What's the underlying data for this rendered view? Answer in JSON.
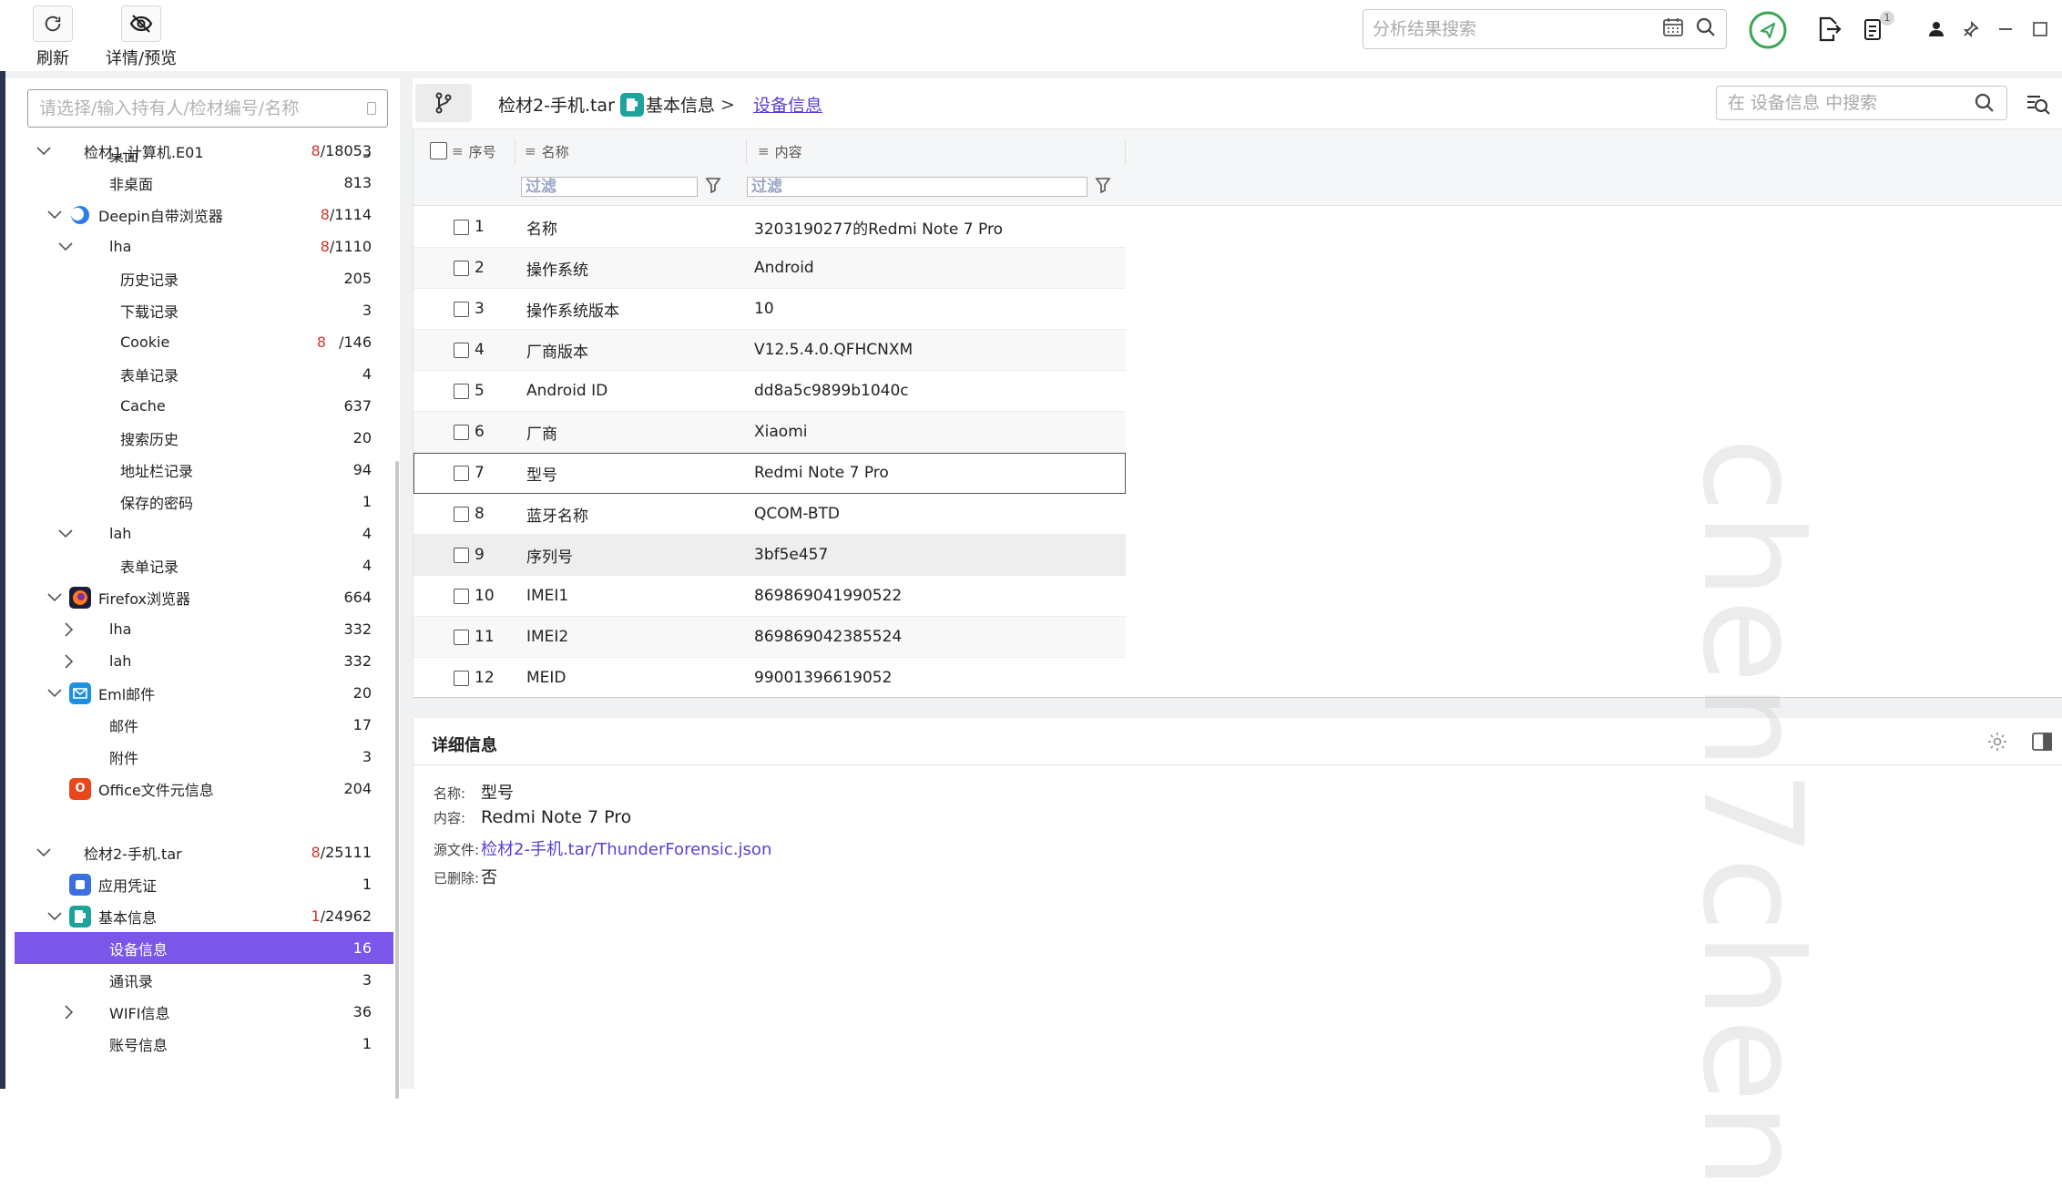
{
  "toolbar": {
    "refresh_label": "刷新",
    "detail_preview_label": "详情/预览",
    "search_placeholder": "分析结果搜索",
    "notification_badge": "1"
  },
  "sidebar": {
    "search_placeholder": "请选择/输入持有人/检材编号/名称",
    "items": [
      {
        "label": "检材1-计算机.E01",
        "count_red": "8",
        "count": "/18053"
      },
      {
        "label": "桌面",
        "count_red": "",
        "count": "5"
      },
      {
        "label": "非桌面",
        "count_red": "",
        "count": "813"
      },
      {
        "label": "Deepin自带浏览器",
        "count_red": "8",
        "count": "/1114"
      },
      {
        "label": "lha",
        "count_red": "8",
        "count": "/1110"
      },
      {
        "label": "历史记录",
        "count_red": "",
        "count": "205"
      },
      {
        "label": "下载记录",
        "count_red": "",
        "count": "3"
      },
      {
        "label": "Cookie",
        "count_red": "8",
        "count": "/146"
      },
      {
        "label": "表单记录",
        "count_red": "",
        "count": "4"
      },
      {
        "label": "Cache",
        "count_red": "",
        "count": "637"
      },
      {
        "label": "搜索历史",
        "count_red": "",
        "count": "20"
      },
      {
        "label": "地址栏记录",
        "count_red": "",
        "count": "94"
      },
      {
        "label": "保存的密码",
        "count_red": "",
        "count": "1"
      },
      {
        "label": "lah",
        "count_red": "",
        "count": "4"
      },
      {
        "label": "表单记录",
        "count_red": "",
        "count": "4"
      },
      {
        "label": "Firefox浏览器",
        "count_red": "",
        "count": "664"
      },
      {
        "label": "lha",
        "count_red": "",
        "count": "332"
      },
      {
        "label": "lah",
        "count_red": "",
        "count": "332"
      },
      {
        "label": "Eml邮件",
        "count_red": "",
        "count": "20"
      },
      {
        "label": "邮件",
        "count_red": "",
        "count": "17"
      },
      {
        "label": "附件",
        "count_red": "",
        "count": "3"
      },
      {
        "label": "Office文件元信息",
        "count_red": "",
        "count": "204"
      },
      {
        "label": "检材2-手机.tar",
        "count_red": "8",
        "count": "/25111"
      },
      {
        "label": "应用凭证",
        "count_red": "",
        "count": "1"
      },
      {
        "label": "基本信息",
        "count_red": "1",
        "count": "/24962"
      },
      {
        "label": "设备信息",
        "count_red": "",
        "count": "16"
      },
      {
        "label": "通讯录",
        "count_red": "",
        "count": "3"
      },
      {
        "label": "WIFI信息",
        "count_red": "",
        "count": "36"
      },
      {
        "label": "账号信息",
        "count_red": "",
        "count": "1"
      }
    ]
  },
  "breadcrumb": {
    "item1": "检材2-手机.tar",
    "item2": "基本信息",
    "item3": "设备信息",
    "sep": ">",
    "search_placeholder": "在 设备信息 中搜索"
  },
  "table": {
    "headers": {
      "index": "序号",
      "name": "名称",
      "content": "内容"
    },
    "filter_placeholder": "过滤",
    "rows": [
      {
        "idx": "1",
        "name": "名称",
        "value": "3203190277的Redmi Note 7 Pro"
      },
      {
        "idx": "2",
        "name": "操作系统",
        "value": "Android"
      },
      {
        "idx": "3",
        "name": "操作系统版本",
        "value": "10"
      },
      {
        "idx": "4",
        "name": "厂商版本",
        "value": "V12.5.4.0.QFHCNXM"
      },
      {
        "idx": "5",
        "name": "Android ID",
        "value": "dd8a5c9899b1040c"
      },
      {
        "idx": "6",
        "name": "厂商",
        "value": "Xiaomi"
      },
      {
        "idx": "7",
        "name": "型号",
        "value": "Redmi Note 7 Pro"
      },
      {
        "idx": "8",
        "name": "蓝牙名称",
        "value": "QCOM-BTD"
      },
      {
        "idx": "9",
        "name": "序列号",
        "value": "3bf5e457"
      },
      {
        "idx": "10",
        "name": "IMEI1",
        "value": "869869041990522"
      },
      {
        "idx": "11",
        "name": "IMEI2",
        "value": "869869042385524"
      },
      {
        "idx": "12",
        "name": "MEID",
        "value": "99001396619052"
      }
    ]
  },
  "detail": {
    "title": "详细信息",
    "name_key": "名称:",
    "name_val": "型号",
    "content_key": "内容:",
    "content_val": "Redmi Note 7 Pro",
    "source_key": "源文件:",
    "source_val": "检材2-手机.tar/ThunderForensic.json",
    "deleted_key": "已删除:",
    "deleted_val": "否"
  },
  "watermark": "chen7chen",
  "colors": {
    "accent": "#7a57e8",
    "red_count": "#d0352b",
    "link": "#5a3fd6",
    "green_ring": "#3aa655"
  }
}
